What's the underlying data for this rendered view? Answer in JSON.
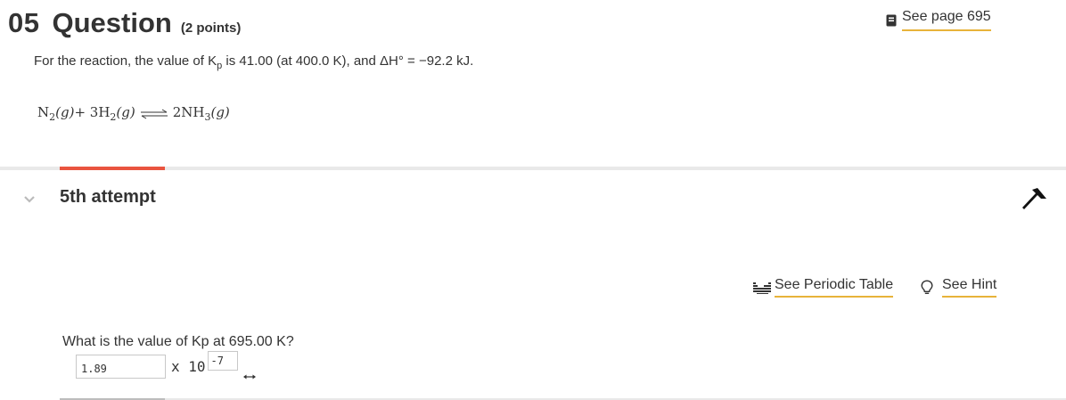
{
  "question": {
    "number": "05",
    "word": "Question",
    "points": "(2 points)"
  },
  "see_page": {
    "label": "See page 695",
    "icon": "book-icon"
  },
  "prompt": {
    "text_before_sub": "For the reaction, the value of K",
    "subscript": "p",
    "text_after_sub": " is 41.00 (at 400.0 K), and ΔH° = −92.2 kJ."
  },
  "equation": {
    "reactant1": "N",
    "reactant1_sub": "2",
    "reactant1_state": "(g)",
    "plus": " + 3H",
    "reactant2_sub": "2",
    "reactant2_state": "(g)",
    "product": "2NH",
    "product_sub": "3",
    "product_state": "(g)",
    "arrow_icon": "equilibrium-arrows-icon"
  },
  "colors": {
    "accent_tab": "#e9543f",
    "link_underline": "#e8b33a",
    "text": "#333333",
    "divider": "#e9e9e9"
  },
  "attempt": {
    "title": "5th attempt",
    "collapse_icon": "chevron-down-icon",
    "pin_icon": "pin-icon"
  },
  "tools": {
    "periodic_label": "See Periodic Table",
    "periodic_icon": "periodic-table-icon",
    "hint_label": "See Hint",
    "hint_icon": "lightbulb-icon"
  },
  "sub_question": {
    "text": "What is the value of Kp at 695.00  K?"
  },
  "answer": {
    "mantissa": "1.89",
    "times_label": "x 10",
    "exponent": "-7",
    "resize_icon": "resize-arrows-icon"
  }
}
